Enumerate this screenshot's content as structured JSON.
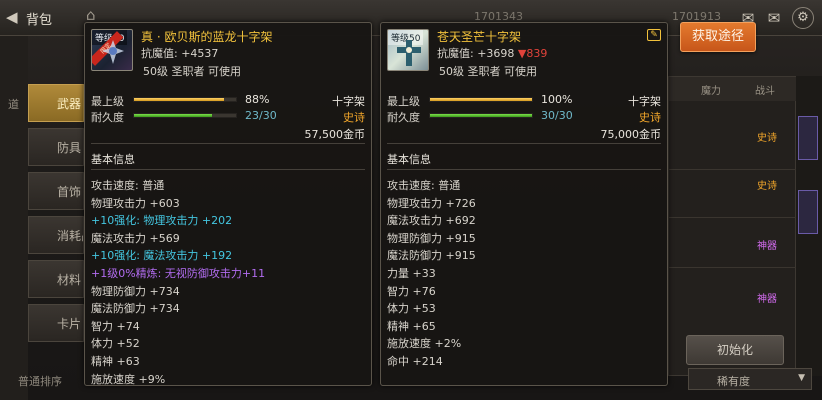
{
  "topbar": {
    "back_arrow": "◀",
    "title": "背包",
    "home_icon": "home-icon",
    "faded_res_1": "1701343",
    "faded_res_2": "1701913"
  },
  "sidebar": {
    "tabs": [
      "武器",
      "防具",
      "首饰",
      "消耗品",
      "材料",
      "卡片"
    ],
    "active_index": 0,
    "sort_label": "普通排序",
    "left_edge_label": "道"
  },
  "list": {
    "header_col1": "魔力",
    "header_col2": "战斗",
    "rows": [
      {
        "grade": "史诗",
        "color": "#f2a62a"
      },
      {
        "grade": "史诗",
        "color": "#f2a62a"
      },
      {
        "grade": "神器",
        "color": "#d46cf0"
      },
      {
        "grade": "神器",
        "color": "#d46cf0"
      }
    ]
  },
  "buttons": {
    "acquire": "获取途径",
    "initialize": "初始化",
    "rarity_select": "稀有度",
    "rarity_arrow": "▼"
  },
  "colors": {
    "accent_orange": "#e47a2e",
    "gold_text": "#f2c23c",
    "epic_orange": "#f2a62a",
    "cyan_stat": "#44c6e0",
    "purple_stat": "#b26cf0",
    "red_down": "#e0433b"
  },
  "left_item": {
    "icon": "dragon-cross-icon",
    "level_tag": "等级30",
    "ribbon": "限定",
    "name": "真 · 欧贝斯的蓝龙十字架",
    "resist": "抗魔值: +4537",
    "resist_diff": "",
    "requirement": "50级 圣职者 可使用",
    "top_level_label": "最上级",
    "top_level_value": "88%",
    "top_level_fraction": 0.88,
    "durability_label": "耐久度",
    "durability_value": "23/30",
    "durability_fraction": 0.7667,
    "type": "十字架",
    "grade": "史诗",
    "price": "57,500金币",
    "section_title": "基本信息",
    "stats": [
      {
        "text": "攻击速度: 普通",
        "style": "normal"
      },
      {
        "text": "物理攻击力 +603",
        "style": "normal"
      },
      {
        "text": "+10强化: 物理攻击力 +202",
        "style": "cyan"
      },
      {
        "text": "魔法攻击力 +569",
        "style": "normal"
      },
      {
        "text": "+10强化: 魔法攻击力 +192",
        "style": "cyan"
      },
      {
        "text": "+1级0%精炼: 无视防御攻击力+11",
        "style": "purple"
      },
      {
        "text": "物理防御力 +734",
        "style": "normal"
      },
      {
        "text": "魔法防御力 +734",
        "style": "normal"
      },
      {
        "text": "智力 +74",
        "style": "normal"
      },
      {
        "text": "体力 +52",
        "style": "normal"
      },
      {
        "text": "精神 +63",
        "style": "normal"
      },
      {
        "text": "施放速度 +9%",
        "style": "normal"
      }
    ]
  },
  "right_item": {
    "icon": "heavenly-cross-icon",
    "level_tag": "等级50",
    "name": "苍天圣芒十字架",
    "resist": "抗魔值: +3698",
    "resist_diff": "▼839",
    "requirement": "50级 圣职者 可使用",
    "edit_icon": "edit-icon",
    "top_level_label": "最上级",
    "top_level_value": "100%",
    "top_level_fraction": 1.0,
    "durability_label": "耐久度",
    "durability_value": "30/30",
    "durability_fraction": 1.0,
    "type": "十字架",
    "grade": "史诗",
    "price": "75,000金币",
    "section_title": "基本信息",
    "stats": [
      {
        "text": "攻击速度: 普通",
        "style": "normal"
      },
      {
        "text": "物理攻击力 +726",
        "style": "normal"
      },
      {
        "text": "魔法攻击力 +692",
        "style": "normal"
      },
      {
        "text": "物理防御力 +915",
        "style": "normal"
      },
      {
        "text": "魔法防御力 +915",
        "style": "normal"
      },
      {
        "text": "力量 +33",
        "style": "normal"
      },
      {
        "text": "智力 +76",
        "style": "normal"
      },
      {
        "text": "体力 +53",
        "style": "normal"
      },
      {
        "text": "精神 +65",
        "style": "normal"
      },
      {
        "text": "施放速度 +2%",
        "style": "normal"
      },
      {
        "text": "命中 +214",
        "style": "normal"
      }
    ]
  }
}
